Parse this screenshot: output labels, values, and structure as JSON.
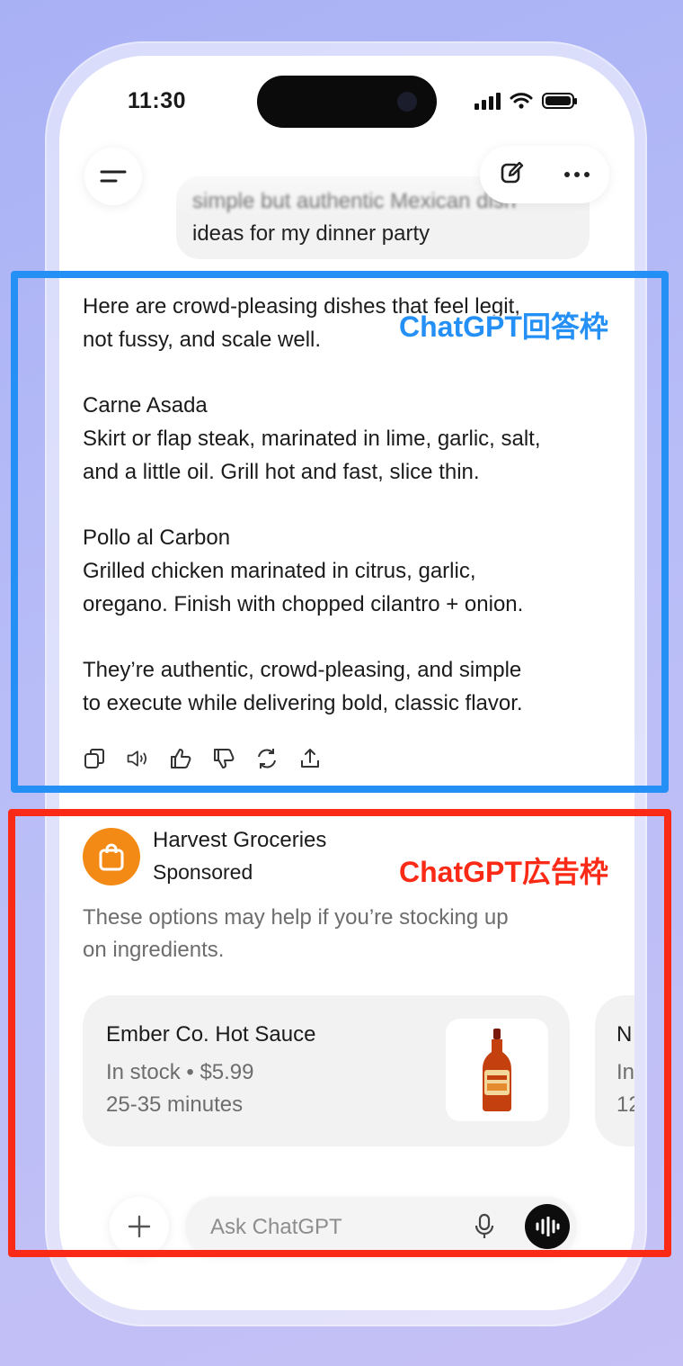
{
  "status_bar": {
    "time": "11:30"
  },
  "header": {
    "menu_icon": "menu-icon",
    "compose_icon": "compose-icon",
    "more_icon": "more-icon"
  },
  "user_message": {
    "line1": "simple but authentic Mexican dish",
    "line2": "ideas for my dinner party"
  },
  "assistant_answer": {
    "intro_line1": "Here are crowd-pleasing dishes that feel legit,",
    "intro_line2": "not fussy, and scale well.",
    "dish1_title": "Carne Asada",
    "dish1_line1": "Skirt or flap steak, marinated in lime, garlic, salt,",
    "dish1_line2": "and a little oil. Grill hot and fast, slice thin.",
    "dish2_title": "Pollo al Carbon",
    "dish2_line1": "Grilled chicken marinated in citrus, garlic,",
    "dish2_line2": "oregano. Finish with chopped cilantro + onion.",
    "closing_line1": "They’re authentic, crowd-pleasing, and simple",
    "closing_line2": "to execute while delivering bold, classic flavor.",
    "action_icons": [
      "copy-icon",
      "read-aloud-icon",
      "thumbs-up-icon",
      "thumbs-down-icon",
      "regenerate-icon",
      "share-icon"
    ]
  },
  "sponsor": {
    "brand_name": "Harvest Groceries",
    "sponsored_label": "Sponsored",
    "description_line1": "These options may help if you’re stocking up",
    "description_line2": "on ingredients.",
    "brand_color": "#f48a16",
    "products": [
      {
        "name": "Ember Co. Hot Sauce",
        "stock_price": "In stock • $5.99",
        "delivery": "25-35 minutes"
      },
      {
        "name": "N",
        "stock_price": "In",
        "delivery": "12"
      }
    ]
  },
  "composer": {
    "placeholder": "Ask ChatGPT",
    "plus_icon": "plus-icon",
    "mic_icon": "mic-icon",
    "voice_icon": "voice-mode-icon"
  },
  "annotations": {
    "answer_frame_label": "ChatGPT回答枠",
    "ad_frame_label": "ChatGPT広告枠",
    "answer_frame_color": "#2490f6",
    "ad_frame_color": "#fb2a16"
  }
}
